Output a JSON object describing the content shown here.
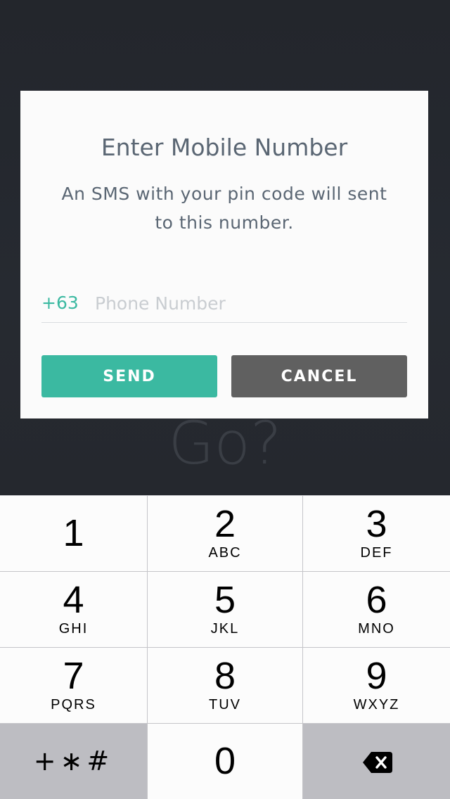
{
  "background": {
    "ghost_text": "Go?"
  },
  "dialog": {
    "title": "Enter Mobile Number",
    "message": "An SMS with your pin code will sent to this number.",
    "country_code": "+63",
    "phone_placeholder": "Phone Number",
    "phone_value": "",
    "send_label": "SEND",
    "cancel_label": "CANCEL"
  },
  "colors": {
    "accent": "#3bb9a1",
    "cancel": "#606060",
    "text": "#5a6673",
    "background": "#262a31"
  },
  "keypad": {
    "keys": [
      {
        "digit": "1",
        "letters": ""
      },
      {
        "digit": "2",
        "letters": "ABC"
      },
      {
        "digit": "3",
        "letters": "DEF"
      },
      {
        "digit": "4",
        "letters": "GHI"
      },
      {
        "digit": "5",
        "letters": "JKL"
      },
      {
        "digit": "6",
        "letters": "MNO"
      },
      {
        "digit": "7",
        "letters": "PQRS"
      },
      {
        "digit": "8",
        "letters": "TUV"
      },
      {
        "digit": "9",
        "letters": "WXYZ"
      }
    ],
    "symbols": "+∗#",
    "zero": "0",
    "delete_icon": "backspace-icon"
  }
}
